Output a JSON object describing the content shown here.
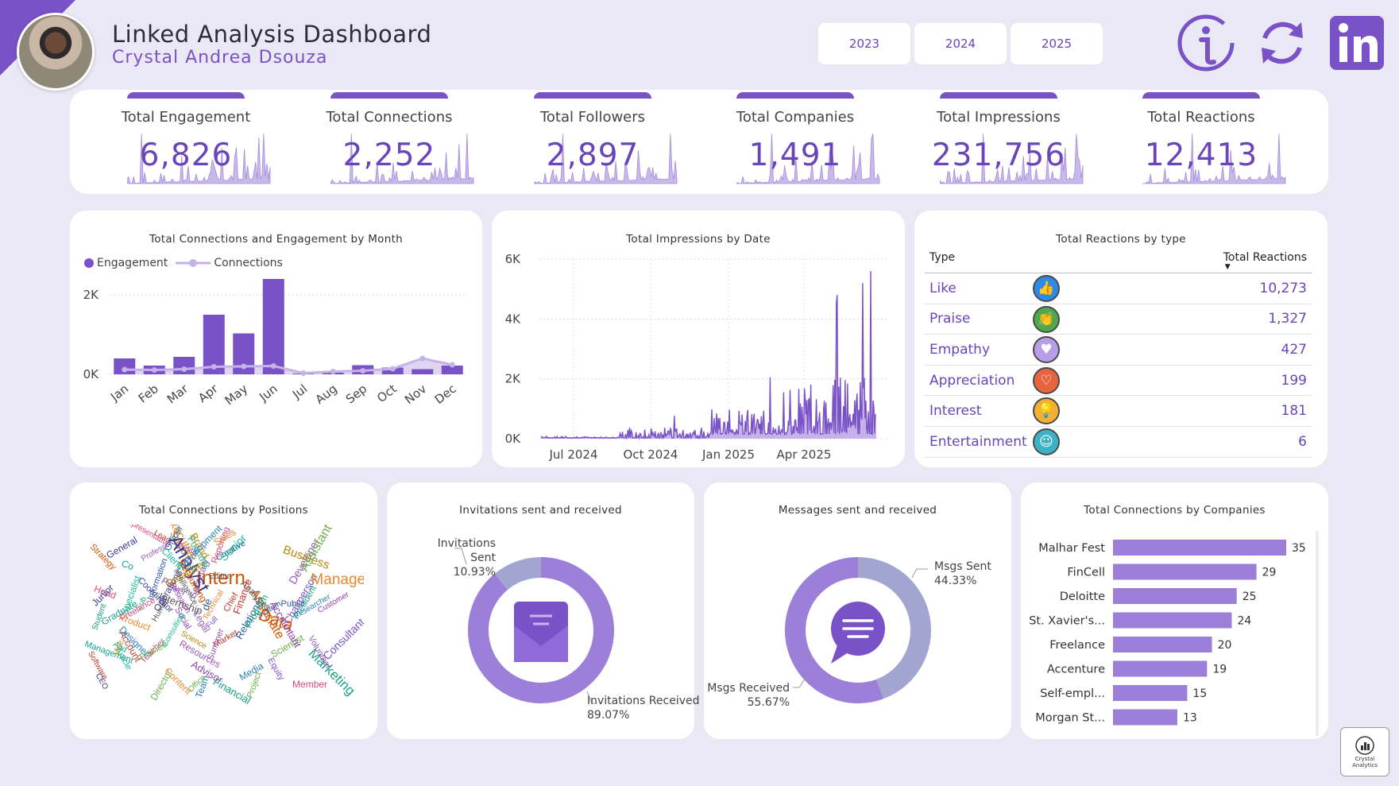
{
  "header": {
    "title": "Linked Analysis Dashboard",
    "subtitle": "Crystal Andrea Dsouza",
    "years": [
      "2023",
      "2024",
      "2025"
    ],
    "icons": [
      "info-icon",
      "refresh-icon",
      "linkedin-icon"
    ]
  },
  "colors": {
    "accent": "#7a52c7",
    "accent_light": "#c4b2e8",
    "accent_mid": "#9b7fd9",
    "gray_purple": "#a3a5d1",
    "background": "#ebe8f5"
  },
  "kpis": [
    {
      "label": "Total Engagement",
      "value": "6,826"
    },
    {
      "label": "Total Connections",
      "value": "2,252"
    },
    {
      "label": "Total Followers",
      "value": "2,897"
    },
    {
      "label": "Total Companies",
      "value": "1,491"
    },
    {
      "label": "Total Impressions",
      "value": "231,756"
    },
    {
      "label": "Total Reactions",
      "value": "12,413"
    }
  ],
  "monthly": {
    "title": "Total Connections and Engagement by Month",
    "legend": [
      "Engagement",
      "Connections"
    ],
    "yticks": [
      "2K",
      "0K"
    ],
    "chart_data": {
      "type": "bar",
      "categories": [
        "Jan",
        "Feb",
        "Mar",
        "Apr",
        "May",
        "Jun",
        "Jul",
        "Aug",
        "Sep",
        "Oct",
        "Nov",
        "Dec"
      ],
      "series": [
        {
          "name": "Engagement",
          "values": [
            400,
            220,
            440,
            1500,
            1030,
            2400,
            20,
            40,
            230,
            170,
            130,
            220
          ]
        },
        {
          "name": "Connections",
          "values": [
            120,
            110,
            130,
            190,
            200,
            210,
            30,
            70,
            90,
            140,
            400,
            240
          ]
        }
      ],
      "ylim": [
        0,
        3000
      ]
    }
  },
  "impressions": {
    "title": "Total Impressions by Date",
    "yticks": [
      "6K",
      "4K",
      "2K",
      "0K"
    ],
    "xticks": [
      "Jul 2024",
      "Oct 2024",
      "Jan 2025",
      "Apr 2025"
    ],
    "chart_data": {
      "type": "area",
      "x_range": [
        "2024-05-01",
        "2025-07-31"
      ],
      "ylim": [
        0,
        6000
      ],
      "peak": 5600
    }
  },
  "reactions": {
    "title": "Total Reactions by type",
    "col_type": "Type",
    "col_total": "Total Reactions",
    "rows": [
      {
        "type": "Like",
        "value": "10,273",
        "icon": "like-icon",
        "color": "#2d8ae6",
        "glyph": "👍"
      },
      {
        "type": "Praise",
        "value": "1,327",
        "icon": "praise-icon",
        "color": "#4fa84a",
        "glyph": "👏"
      },
      {
        "type": "Empathy",
        "value": "427",
        "icon": "empathy-icon",
        "color": "#b89ee8",
        "glyph": "♥"
      },
      {
        "type": "Appreciation",
        "value": "199",
        "icon": "appreciation-icon",
        "color": "#e8643e",
        "glyph": "♡"
      },
      {
        "type": "Interest",
        "value": "181",
        "icon": "interest-icon",
        "color": "#f2b134",
        "glyph": "💡"
      },
      {
        "type": "Entertainment",
        "value": "6",
        "icon": "entertainment-icon",
        "color": "#3bb3c4",
        "glyph": "☺"
      }
    ]
  },
  "positions": {
    "title": "Total Connections by Positions",
    "words": [
      "Creative",
      "Reporting",
      "Secretary",
      "Graduate",
      "Product",
      "CEO",
      "Office",
      "Market",
      "Customer",
      "Client",
      "Support",
      "Researcher",
      "Resources",
      "Sub",
      "Science",
      "Internship",
      "Public",
      "Teacher",
      "Equity",
      "Marketing",
      "Sales",
      "Coordinator",
      "Director",
      "Chief",
      "Advisor",
      "Article",
      "Strategy",
      "Media",
      "Developer",
      "Student",
      "Business",
      "Human",
      "Information",
      "Representative",
      "Digital",
      "Management",
      "Content",
      "Operations",
      "Assistant",
      "Lead",
      "Social",
      "Founder",
      "Associate",
      "Team",
      "Summer",
      "Financial",
      "Brand",
      "Analytics",
      "de",
      "Head",
      "Consultant",
      "Co",
      "Executive",
      "Junior",
      "Trainee",
      "Finance",
      "Research",
      "Senior",
      "Intern",
      "Officer",
      "Legal",
      "Writer",
      "Vice",
      "Editor",
      "System",
      "Member",
      "Chairperson",
      "And",
      "Manager",
      "Analyst",
      "Scientist",
      "Account",
      "Power",
      "Specialist",
      "Data",
      "Development",
      "Volunteer",
      "President",
      "Organizer",
      "Intelligence",
      "Relations",
      "Freelance",
      "Full",
      "Program",
      "Technical",
      "General",
      "Project",
      "Software",
      "Accountant",
      "Consulting",
      "Accounting",
      "Designer",
      "Professor"
    ]
  },
  "invitations": {
    "title": "Invitations sent and received",
    "sent_label": "Invitations Sent",
    "sent_pct": "10.93%",
    "received_label": "Invitations Received",
    "received_pct": "89.07%",
    "chart_data": {
      "type": "pie",
      "labels": [
        "Invitations Sent",
        "Invitations Received"
      ],
      "values": [
        10.93,
        89.07
      ]
    }
  },
  "messages": {
    "title": "Messages sent and received",
    "sent_label": "Msgs Sent",
    "sent_pct": "44.33%",
    "received_label": "Msgs Received",
    "received_pct": "55.67%",
    "chart_data": {
      "type": "pie",
      "labels": [
        "Msgs Sent",
        "Msgs Received"
      ],
      "values": [
        44.33,
        55.67
      ]
    }
  },
  "companies": {
    "title": "Total Connections by Companies",
    "chart_data": {
      "type": "bar",
      "orientation": "horizontal",
      "categories": [
        "Malhar Fest",
        "FinCell",
        "Deloitte",
        "St. Xavier's...",
        "Freelance",
        "Accenture",
        "Self-empl...",
        "Morgan St..."
      ],
      "values": [
        35,
        29,
        25,
        24,
        20,
        19,
        15,
        13
      ]
    }
  },
  "badge": {
    "line1": "Crystal",
    "line2": "Analytics"
  }
}
